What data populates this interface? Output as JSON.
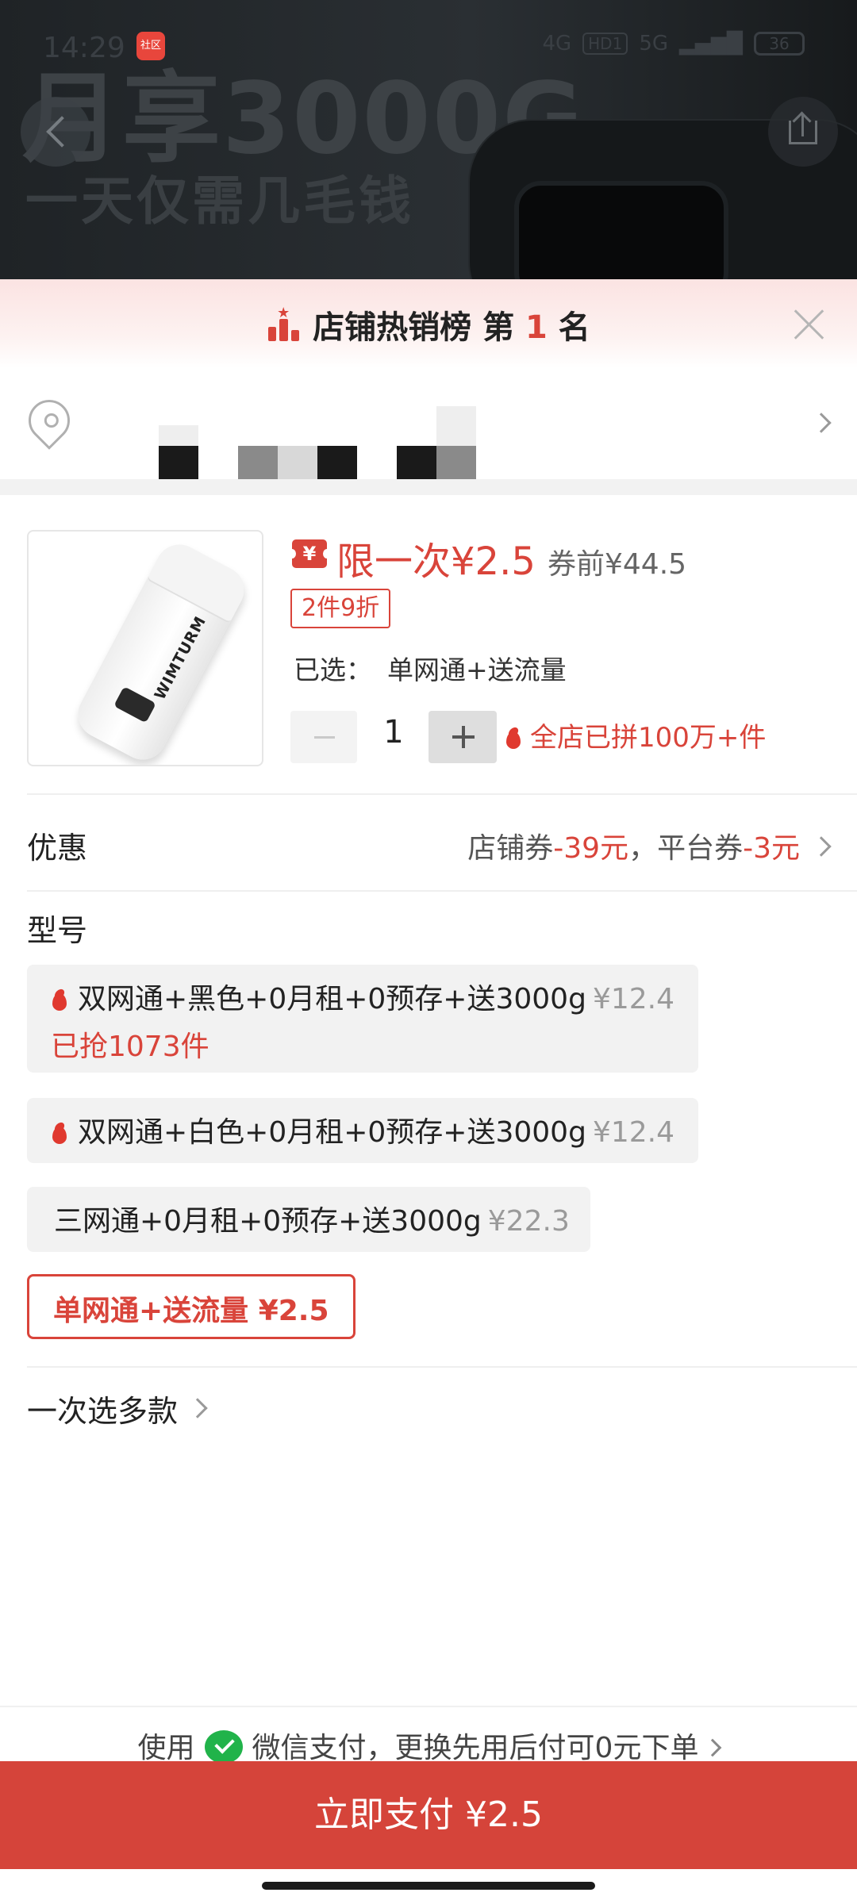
{
  "status_bar": {
    "time": "14:29",
    "app_badge": "社区",
    "network_left": "4G",
    "hd": "HD1",
    "network_right": "5G",
    "battery": "36"
  },
  "banner": {
    "line1": "月享3000G",
    "line2": "一天仅需几毛钱"
  },
  "rank": {
    "prefix": "店铺热销榜 第 ",
    "number": "1",
    "suffix": " 名"
  },
  "product": {
    "brand": "WIMTURM",
    "coupon_icon": "¥",
    "price_label": "限一次¥2.5",
    "price_before": "券前¥44.5",
    "discount_tag": "2件9折",
    "selected_label": "已选：",
    "selected_value": "单网通+送流量",
    "quantity": "1",
    "sold_note": "全店已拼100万+件"
  },
  "promo": {
    "label": "优惠",
    "shop_coupon_label": "店铺券",
    "shop_coupon_value": "-39元",
    "separator": "，平台券",
    "platform_coupon_value": "-3元"
  },
  "model": {
    "label": "型号",
    "options": [
      {
        "name": "双网通+黑色+0月租+0预存+送3000g",
        "price": "¥12.4",
        "sub": "已抢1073件"
      },
      {
        "name": "双网通+白色+0月租+0预存+送3000g",
        "price": "¥12.4"
      },
      {
        "name": "三网通+0月租+0预存+送3000g",
        "price": "¥22.3"
      },
      {
        "name": "单网通+送流量 ¥2.5"
      }
    ]
  },
  "multi_select": "一次选多款",
  "pay_hint": {
    "prefix": "使用",
    "text": "微信支付，更换先用后付可0元下单"
  },
  "pay_button": "立即支付 ¥2.5",
  "colors": {
    "accent": "#d5443a",
    "selected_border": "#d9443a",
    "wechat": "#21b34a"
  }
}
